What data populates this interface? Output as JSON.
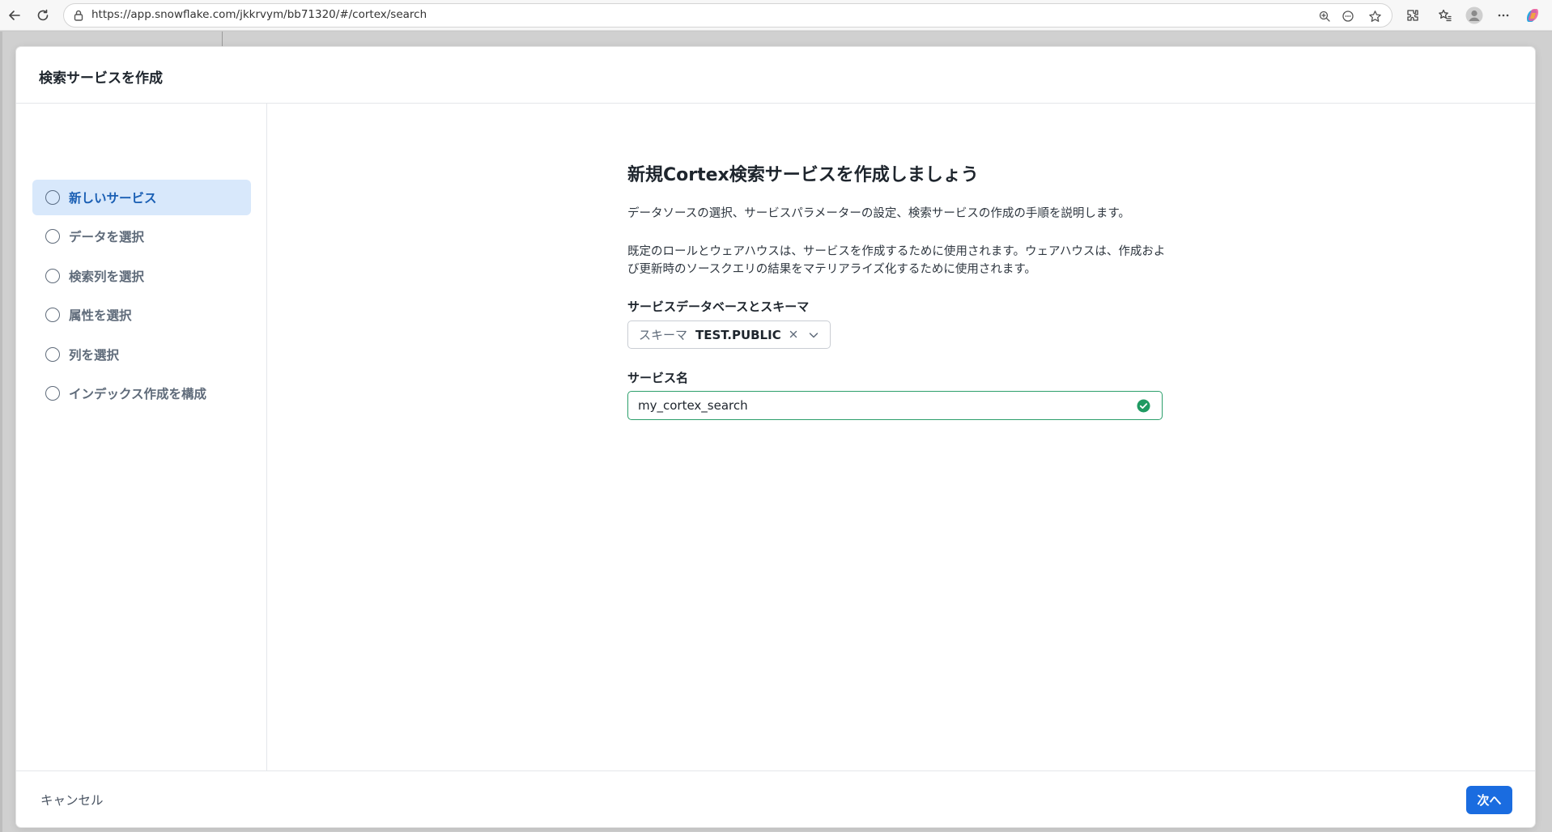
{
  "browser": {
    "url": "https://app.snowflake.com/jkkrvym/bb71320/#/cortex/search",
    "icons": [
      "back-icon",
      "refresh-icon",
      "site-info-icon",
      "zoom-icon",
      "reading-mode-icon",
      "favorite-star-icon",
      "extensions-icon",
      "favorites-icon",
      "profile-avatar",
      "more-icon",
      "copilot-icon"
    ]
  },
  "modal": {
    "title": "検索サービスを作成",
    "steps": [
      {
        "label": "新しいサービス",
        "active": true
      },
      {
        "label": "データを選択",
        "active": false
      },
      {
        "label": "検索列を選択",
        "active": false
      },
      {
        "label": "属性を選択",
        "active": false
      },
      {
        "label": "列を選択",
        "active": false
      },
      {
        "label": "インデックス作成を構成",
        "active": false
      }
    ],
    "content": {
      "heading": "新規Cortex検索サービスを作成しましょう",
      "description_1": "データソースの選択、サービスパラメーターの設定、検索サービスの作成の手順を説明します。",
      "description_2": "既定のロールとウェアハウスは、サービスを作成するために使用されます。ウェアハウスは、作成および更新時のソースクエリの結果をマテリアライズ化するために使用されます。",
      "schema_label": "サービスデータベースとスキーマ",
      "schema_prefix": "スキーマ",
      "schema_value": "TEST.PUBLIC",
      "service_name_label": "サービス名",
      "service_name_value": "my_cortex_search"
    },
    "footer": {
      "cancel_label": "キャンセル",
      "next_label": "次へ"
    }
  },
  "colors": {
    "accent": "#1a6ce0",
    "active_step_bg": "#d8e8fb",
    "valid_green": "#2c9f6b"
  }
}
